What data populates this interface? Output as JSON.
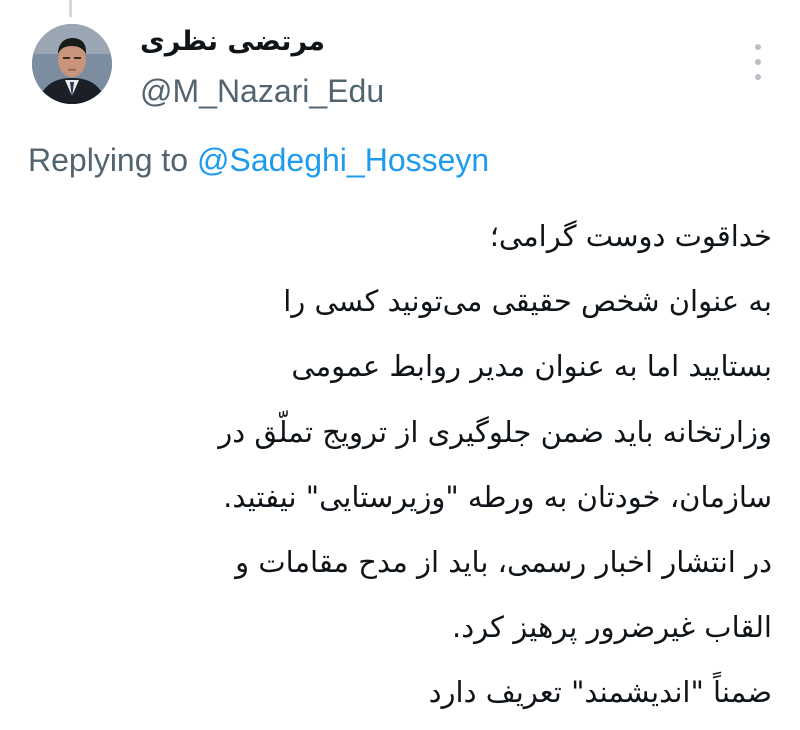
{
  "tweet": {
    "author": {
      "display_name": "مرتضی نظری",
      "handle": "@M_Nazari_Edu",
      "avatar": "avatar-photo"
    },
    "more_icon": "more-vertical-icon",
    "replying": {
      "prefix": "Replying to ",
      "mention": "@Sadeghi_Hosseyn"
    },
    "body_lines": [
      "خداقوت دوست گرامی؛",
      "به عنوان شخص حقیقی می‌تونید کسی را",
      "بستایید اما به عنوان مدیر روابط عمومی",
      "وزارتخانه باید ضمن جلوگیری از ترویج تملّق در",
      "سازمان، خودتان به ورطه \"وزیرستایی\" نیفتید.",
      "در انتشار اخبار رسمی، باید از مدح مقامات و",
      "القاب غیرضرور پرهیز کرد.",
      "ضمناً \"اندیشمند\" تعریف دارد"
    ],
    "colors": {
      "text": "#0f1419",
      "secondary": "#536471",
      "link": "#1d9bf0"
    }
  }
}
